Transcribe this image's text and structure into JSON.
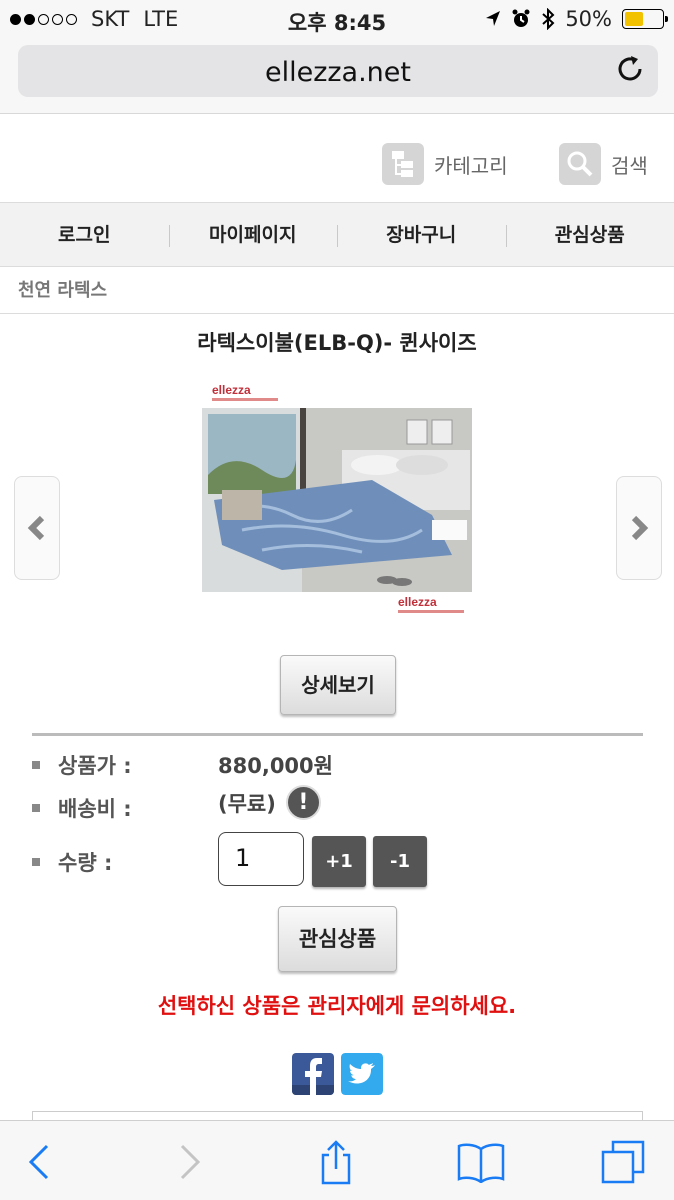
{
  "status_bar": {
    "carrier": "SKT",
    "network": "LTE",
    "time": "오후 8:45",
    "battery": "50%",
    "battery_level": 0.5
  },
  "browser": {
    "url": "ellezza.net"
  },
  "top_tools": {
    "category_label": "카테고리",
    "search_label": "검색"
  },
  "nav": {
    "items": [
      "로그인",
      "마이페이지",
      "장바구니",
      "관심상품"
    ]
  },
  "breadcrumb": "천연 라텍스",
  "product": {
    "title": "라텍스이불(ELB-Q)- 퀸사이즈",
    "brand_logo_text": "ellezza",
    "detail_button": "상세보기",
    "price_label": "상품가 :",
    "price_value": "880,000원",
    "shipping_label": "배송비 :",
    "shipping_value": "(무료)",
    "shipping_info_icon": "!",
    "quantity_label": "수량 :",
    "quantity_value": "1",
    "plus_label": "+1",
    "minus_label": "-1",
    "wishlist_button": "관심상품",
    "notice": "선택하신 상품은 관리자에게 문의하세요."
  },
  "colors": {
    "notice": "#e01010",
    "facebook": "#3b5998",
    "twitter": "#33aaee"
  },
  "icons": [
    "category-icon",
    "search-icon",
    "chevron-left-icon",
    "chevron-right-icon",
    "info-icon",
    "facebook-icon",
    "twitter-icon",
    "back-icon",
    "forward-icon",
    "share-icon",
    "bookmarks-icon",
    "tabs-icon",
    "reload-icon"
  ]
}
